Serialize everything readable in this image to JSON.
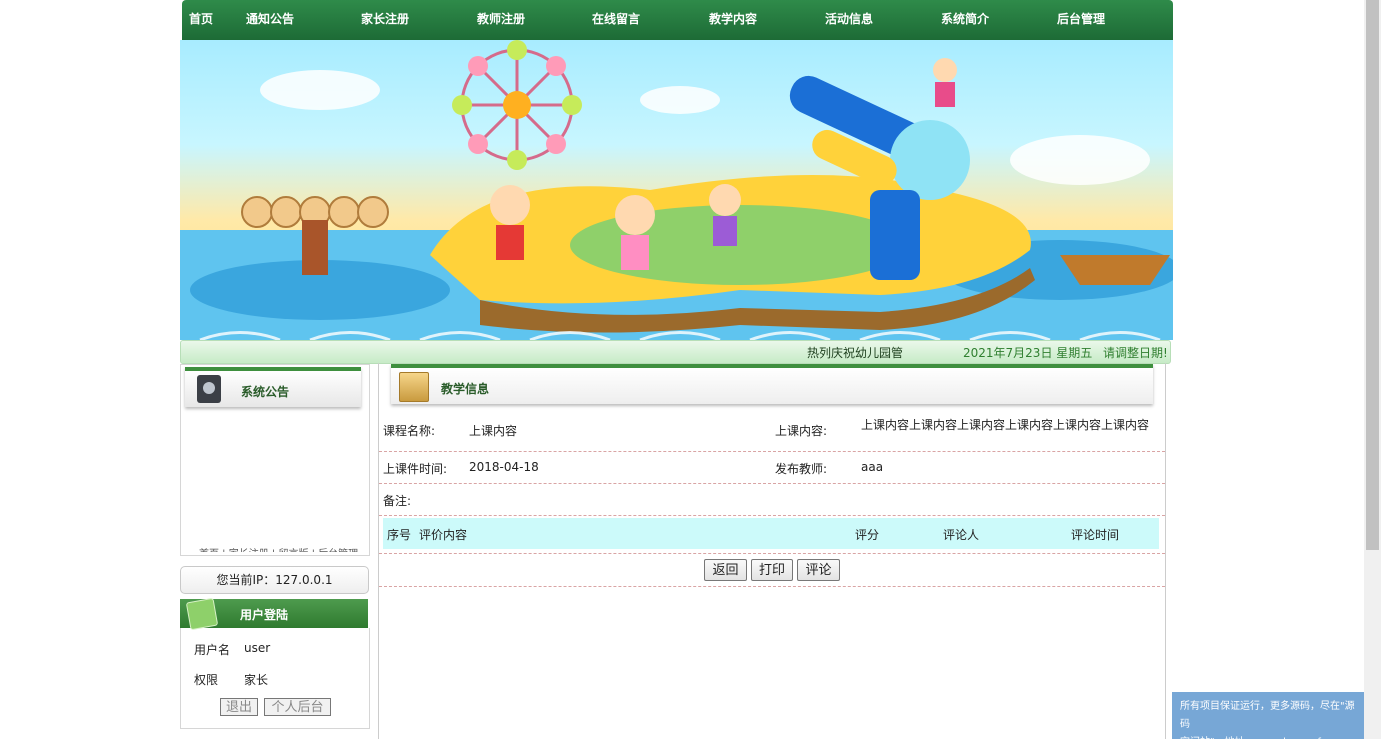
{
  "nav": {
    "items": [
      "首页",
      "通知公告",
      "家长注册",
      "教师注册",
      "在线留言",
      "教学内容",
      "活动信息",
      "系统简介",
      "后台管理"
    ]
  },
  "marquee": {
    "text": "热列庆祝幼儿园管",
    "date": "2021年7月23日 星期五",
    "adjust": "请调整日期!"
  },
  "notice": {
    "title": "系统公告",
    "links_text": "首页 | 家长注册 | 留言版 | 后台管理"
  },
  "ip": {
    "text": "您当前IP：127.0.0.1"
  },
  "login": {
    "title": "用户登陆",
    "username_label": "用户名",
    "username_value": "user",
    "role_label": "权限",
    "role_value": "家长",
    "logout_label": "退出",
    "personal_label": "个人后台"
  },
  "content": {
    "title": "教学信息",
    "course_name_label": "课程名称:",
    "course_name_value": "上课内容",
    "course_content_label": "上课内容:",
    "course_content_value": "上课内容上课内容上课内容上课内容上课内容上课内容",
    "time_label": "上课件时间:",
    "time_value": "2018-04-18",
    "teacher_label": "发布教师:",
    "teacher_value": "aaa",
    "remark_label": "备注:",
    "table_headers": {
      "no": "序号",
      "content": "评价内容",
      "score": "评分",
      "reviewer": "评论人",
      "time": "评论时间"
    },
    "buttons": {
      "back": "返回",
      "print": "打印",
      "comment": "评论"
    }
  },
  "watermark": {
    "line1": "所有项目保证运行，更多源码，尽在\"源码",
    "line2": "空间站\"，地址: www.shuyue.fun"
  }
}
